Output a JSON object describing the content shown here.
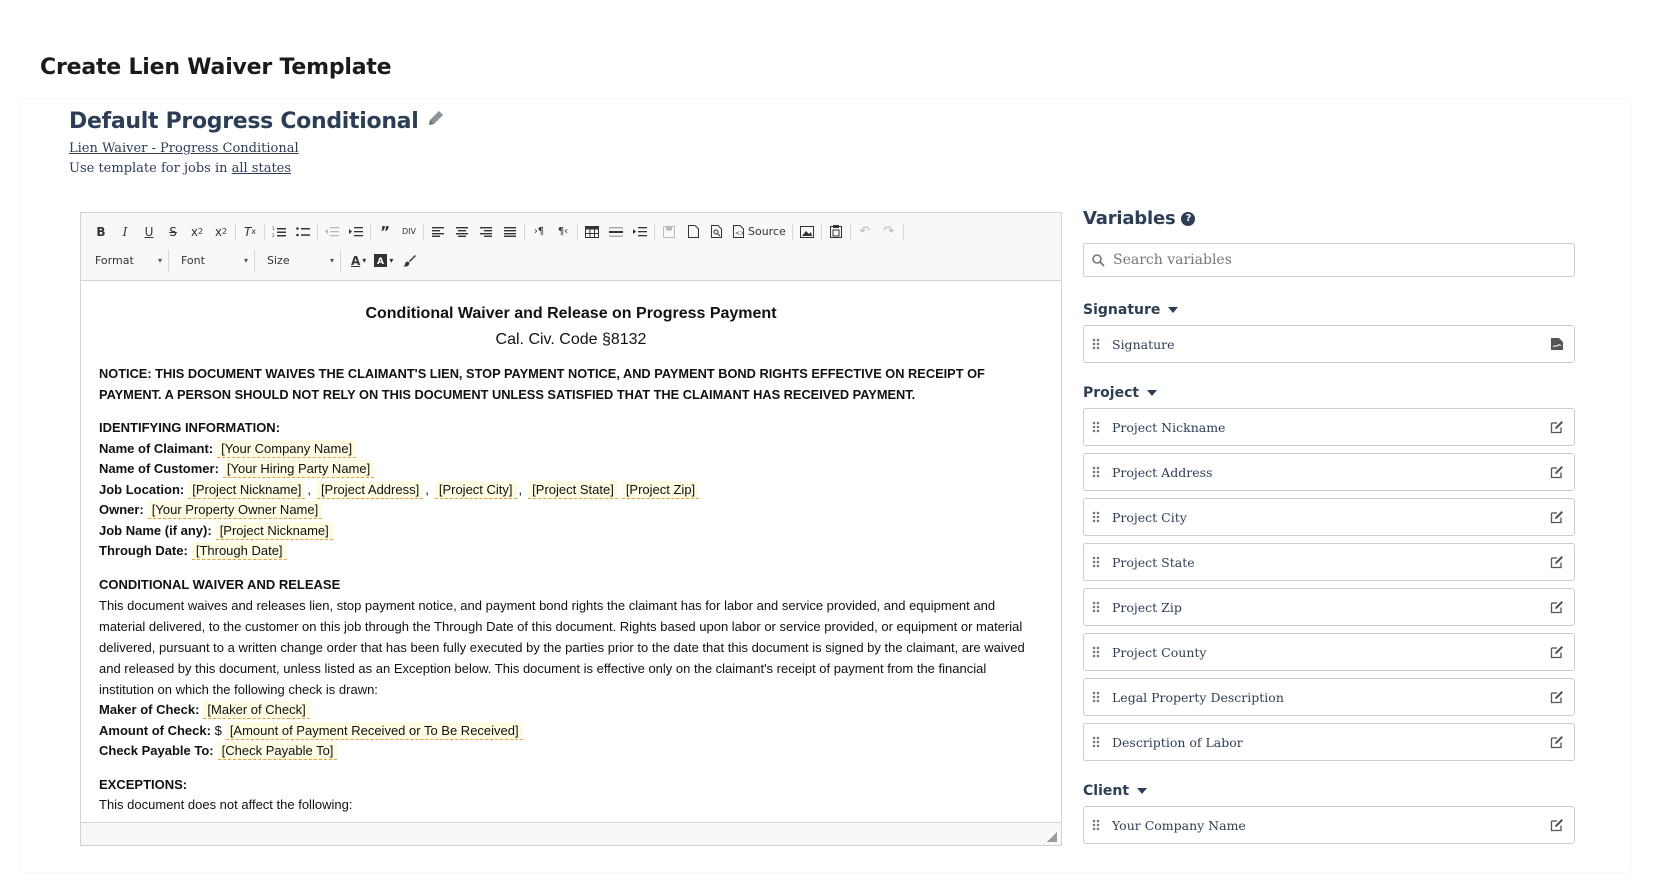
{
  "page": {
    "title": "Create Lien Waiver Template"
  },
  "template": {
    "name": "Default Progress Conditional",
    "type_link": "Lien Waiver - Progress Conditional",
    "states_prefix": "Use template for jobs in ",
    "states_link": "all states"
  },
  "toolbar": {
    "source_label": "Source",
    "format_label": "Format",
    "font_label": "Font",
    "size_label": "Size"
  },
  "document": {
    "title": "Conditional Waiver and Release on Progress Payment",
    "subtitle": "Cal. Civ. Code §8132",
    "notice": "NOTICE: THIS DOCUMENT WAIVES THE CLAIMANT'S LIEN, STOP PAYMENT NOTICE, AND PAYMENT BOND RIGHTS EFFECTIVE ON RECEIPT OF PAYMENT. A PERSON SHOULD NOT RELY ON THIS DOCUMENT UNLESS SATISFIED THAT THE CLAIMANT HAS RECEIVED PAYMENT.",
    "identifying": {
      "heading": "IDENTIFYING INFORMATION:",
      "claimant_label": "Name of Claimant:",
      "claimant_var": "[Your Company Name]",
      "customer_label": "Name of Customer:",
      "customer_var": "[Your Hiring Party Name]",
      "job_location_label": "Job Location:",
      "loc_nickname": "[Project Nickname]",
      "loc_address": "[Project Address]",
      "loc_city": "[Project City]",
      "loc_state": "[Project State]",
      "loc_zip": "[Project Zip]",
      "comma": ",",
      "owner_label": "Owner:",
      "owner_var": "[Your Property Owner Name]",
      "job_name_label": "Job Name (if any):",
      "job_name_var": "[Project Nickname]",
      "through_label": "Through Date:",
      "through_var": "[Through Date]"
    },
    "release": {
      "heading": "CONDITIONAL WAIVER AND RELEASE",
      "body": "This document waives and releases lien, stop payment notice, and payment bond rights the claimant has for labor and service provided, and equipment and material delivered, to the customer on this job through the Through Date of this document. Rights based upon labor or service provided, or equipment or material delivered, pursuant to a written change order that has been fully executed by the parties prior to the date that this document is signed by the claimant, are waived and released by this document, unless listed as an Exception below. This document is effective only on the claimant's receipt of payment from the financial institution on which the following check is drawn:",
      "maker_label": "Maker of Check:",
      "maker_var": "[Maker of Check]",
      "amount_label": "Amount of Check:",
      "amount_prefix": "$",
      "amount_var": "[Amount of Payment Received or To Be Received]",
      "payable_label": "Check Payable To:",
      "payable_var": "[Check Payable To]"
    },
    "exceptions": {
      "heading": "EXCEPTIONS:",
      "body": "This document does not affect the following:"
    }
  },
  "variables": {
    "title": "Variables",
    "search_placeholder": "Search variables",
    "groups": [
      {
        "name": "Signature",
        "items": [
          "Signature"
        ]
      },
      {
        "name": "Project",
        "items": [
          "Project Nickname",
          "Project Address",
          "Project City",
          "Project State",
          "Project Zip",
          "Project County",
          "Legal Property Description",
          "Description of Labor"
        ]
      },
      {
        "name": "Client",
        "items": [
          "Your Company Name"
        ]
      }
    ]
  }
}
